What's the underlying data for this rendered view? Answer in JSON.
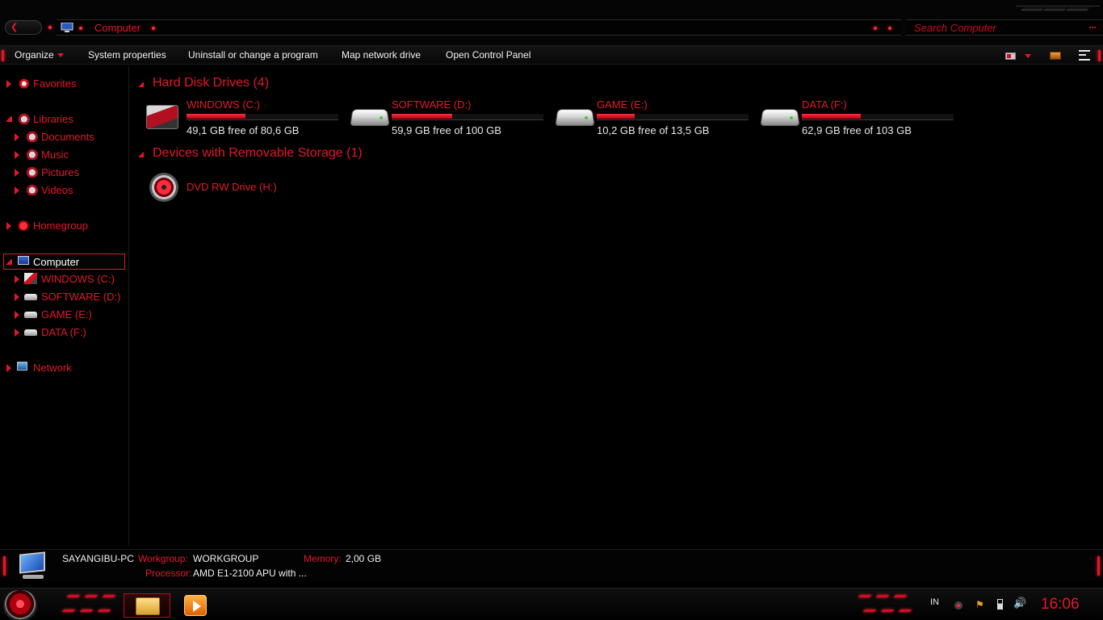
{
  "address": {
    "path": "Computer"
  },
  "search": {
    "placeholder": "Search Computer"
  },
  "toolbar": {
    "organize": "Organize",
    "system_properties": "System properties",
    "uninstall": "Uninstall or change a program",
    "map_drive": "Map network drive",
    "control_panel": "Open Control Panel"
  },
  "nav": {
    "favorites": "Favorites",
    "libraries": "Libraries",
    "documents": "Documents",
    "music": "Music",
    "pictures": "Pictures",
    "videos": "Videos",
    "homegroup": "Homegroup",
    "computer": "Computer",
    "drives": [
      "WINDOWS (C:)",
      "SOFTWARE (D:)",
      "GAME (E:)",
      "DATA (F:)"
    ],
    "network": "Network"
  },
  "groups": {
    "hdd": "Hard Disk Drives (4)",
    "removable": "Devices with Removable Storage (1)"
  },
  "drives": [
    {
      "name": "WINDOWS (C:)",
      "free": "49,1 GB free of 80,6 GB",
      "used_fraction": 0.39
    },
    {
      "name": "SOFTWARE (D:)",
      "free": "59,9 GB free of 100 GB",
      "used_fraction": 0.4
    },
    {
      "name": "GAME (E:)",
      "free": "10,2 GB free of 13,5 GB",
      "used_fraction": 0.25
    },
    {
      "name": "DATA (F:)",
      "free": "62,9 GB free of 103 GB",
      "used_fraction": 0.39
    }
  ],
  "removable": {
    "name": "DVD RW Drive (H:)"
  },
  "details": {
    "pc_name": "SAYANGIBU-PC",
    "workgroup_label": "Workgroup:",
    "workgroup": "WORKGROUP",
    "memory_label": "Memory:",
    "memory": "2,00 GB",
    "processor_label": "Processor:",
    "processor": "AMD E1-2100 APU with ..."
  },
  "taskbar": {
    "lang": "IN",
    "clock": "16:06"
  },
  "colors": {
    "accent": "#e0182a",
    "background": "#000000",
    "text": "#e8e8e8"
  },
  "icons": {
    "back": "back-arrow-icon",
    "computer": "computer-icon",
    "search": "search-icon",
    "drive": "hard-drive-icon",
    "dvd": "dvd-drive-icon",
    "start": "start-orb-icon",
    "explorer": "folder-icon",
    "player": "media-player-icon"
  }
}
